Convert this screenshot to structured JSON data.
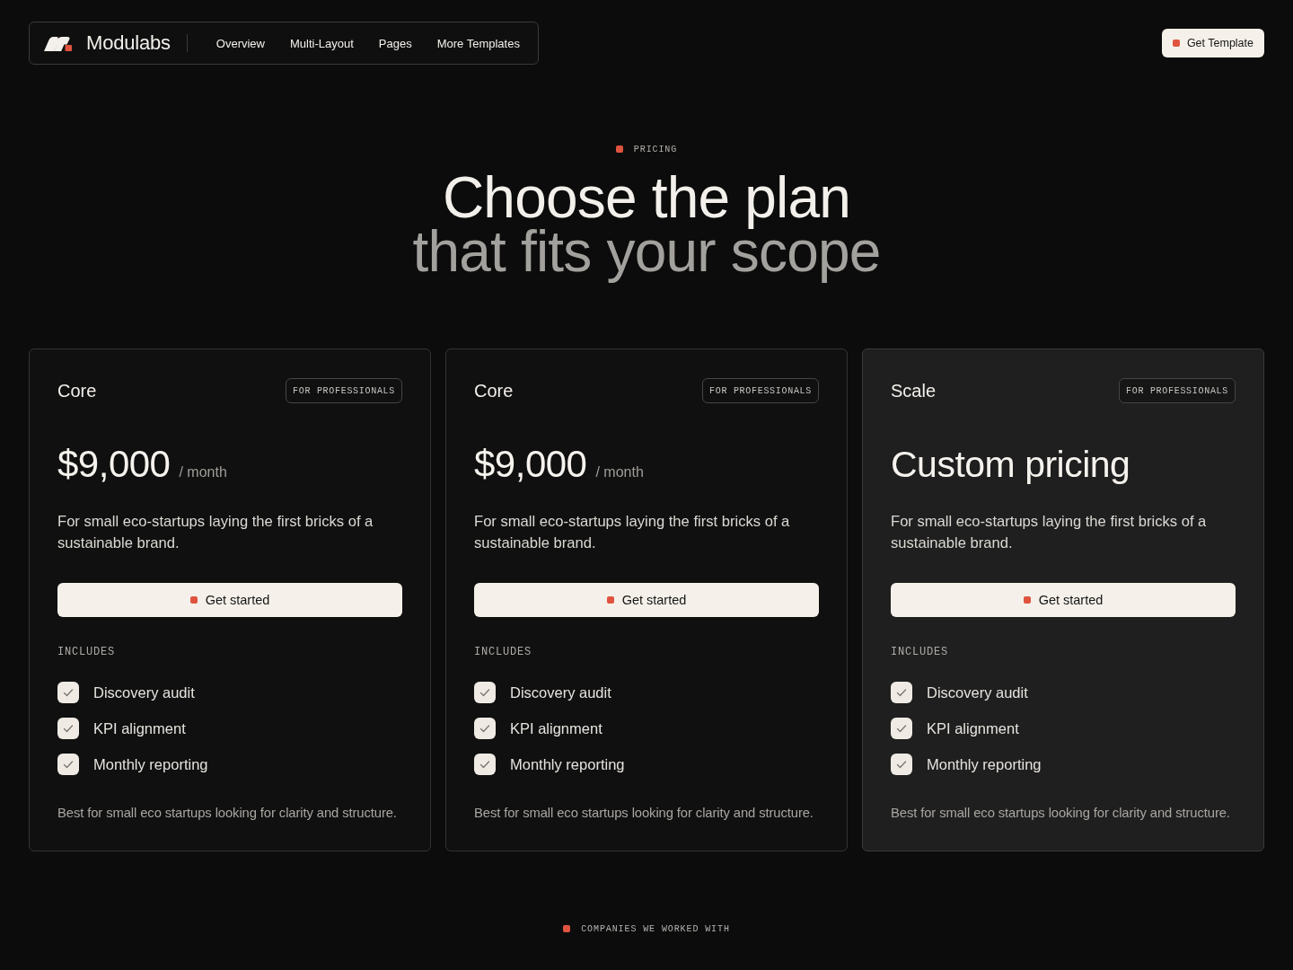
{
  "nav": {
    "brand": "Modulabs",
    "links": [
      "Overview",
      "Multi-Layout",
      "Pages",
      "More Templates"
    ],
    "cta": "Get Template"
  },
  "hero": {
    "eyebrow": "PRICING",
    "heading": [
      {
        "text": "Choose the plan",
        "muted": false
      },
      {
        "text": "that fits your scope",
        "muted": true
      }
    ]
  },
  "plans": [
    {
      "name": "Core",
      "tag": "FOR PROFESSIONALS",
      "kind": "fixed",
      "price": "$9,000",
      "period": "/ month",
      "description": "For small eco-startups laying the first bricks of a sustainable brand.",
      "button": "Get started",
      "includes_label": "INCLUDES",
      "features": [
        {
          "label": "Discovery audit",
          "checked": true
        },
        {
          "label": "KPI alignment",
          "checked": true
        },
        {
          "label": "Monthly reporting",
          "checked": true
        }
      ],
      "note": "Best for small eco startups looking for clarity and structure.",
      "highlighted": false
    },
    {
      "name": "Core",
      "tag": "FOR PROFESSIONALS",
      "kind": "fixed",
      "price": "$9,000",
      "period": "/ month",
      "description": "For small eco-startups laying the first bricks of a sustainable brand.",
      "button": "Get started",
      "includes_label": "INCLUDES",
      "features": [
        {
          "label": "Discovery audit",
          "checked": true
        },
        {
          "label": "KPI alignment",
          "checked": true
        },
        {
          "label": "Monthly reporting",
          "checked": true
        }
      ],
      "note": "Best for small eco startups looking for clarity and structure.",
      "highlighted": false
    },
    {
      "name": "Scale",
      "tag": "FOR PROFESSIONALS",
      "kind": "custom",
      "price": "Custom pricing",
      "description": "For small eco-startups laying the first bricks of a sustainable brand.",
      "button": "Get started",
      "includes_label": "INCLUDES",
      "features": [
        {
          "label": "Discovery audit",
          "checked": true
        },
        {
          "label": "KPI alignment",
          "checked": true
        },
        {
          "label": "Monthly reporting",
          "checked": true
        }
      ],
      "note": "Best for small eco startups looking for clarity and structure.",
      "highlighted": true
    }
  ],
  "companies": {
    "eyebrow": "COMPANIES WE WORKED WITH"
  }
}
